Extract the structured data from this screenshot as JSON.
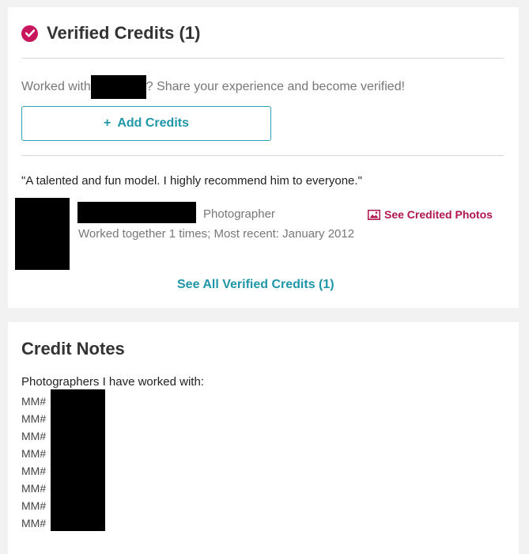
{
  "verified": {
    "title": "Verified Credits (1)",
    "intro_before": "Worked with",
    "intro_after": "? Share your experience and become verified!",
    "add_button": "Add Credits",
    "add_button_icon": "+",
    "quote": "\"A talented and fun model. I highly recommend him to everyone.\"",
    "credit": {
      "role": "Photographer",
      "worked_together": "Worked together 1 times; Most recent: January 2012",
      "see_photos": "See Credited Photos",
      "see_photos_icon": "image-icon"
    },
    "see_all": "See All Verified Credits (1)",
    "accent_color": "#c8175d",
    "link_color": "#1f97a8"
  },
  "notes": {
    "title": "Credit Notes",
    "intro": "Photographers I have worked with:",
    "lines": [
      "MM#",
      "MM#",
      "MM#",
      "MM#",
      "MM#",
      "MM#",
      "MM#",
      "MM#"
    ]
  }
}
